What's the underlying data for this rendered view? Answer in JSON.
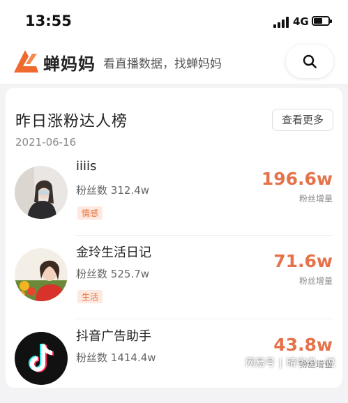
{
  "status": {
    "time": "13:55",
    "network": "4G"
  },
  "header": {
    "app_name": "蝉妈妈",
    "slogan": "看直播数据，找蝉妈妈"
  },
  "section": {
    "title": "昨日涨粉达人榜",
    "more_label": "查看更多",
    "date": "2021-06-16"
  },
  "list": [
    {
      "name": "iiiis",
      "fans_label": "粉丝数",
      "fans": "312.4w",
      "tag": "情感",
      "growth": "196.6w",
      "growth_label": "粉丝增量"
    },
    {
      "name": "金玲生活日记",
      "fans_label": "粉丝数",
      "fans": "525.7w",
      "tag": "生活",
      "growth": "71.6w",
      "growth_label": "粉丝增量"
    },
    {
      "name": "抖音广告助手",
      "fans_label": "粉丝数",
      "fans": "1414.4w",
      "tag": "",
      "growth": "43.8w",
      "growth_label": "粉丝增量"
    }
  ],
  "watermark": {
    "source": "网易号",
    "author": "晴字说一说"
  },
  "colors": {
    "accent": "#e5724a",
    "brand": "#ef6a2e",
    "tag_bg": "#fde9df"
  }
}
